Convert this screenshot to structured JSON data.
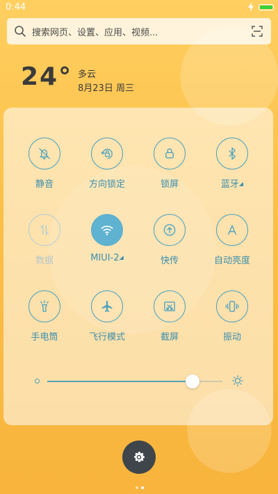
{
  "status_bar": {
    "time": "0:44",
    "battery_level": 1.0
  },
  "search": {
    "placeholder": "搜索网页、设置、应用、视频..."
  },
  "weather": {
    "temperature": "24°",
    "condition": "多云",
    "date": "8月23日 周三"
  },
  "quick_toggles": [
    {
      "label": "静音",
      "icon": "bell-off-icon",
      "state": "inactive"
    },
    {
      "label": "方向锁定",
      "icon": "rotation-lock-icon",
      "state": "inactive"
    },
    {
      "label": "锁屏",
      "icon": "lock-icon",
      "state": "inactive"
    },
    {
      "label": "蓝牙",
      "icon": "bluetooth-icon",
      "state": "inactive",
      "expandable": true
    },
    {
      "label": "数据",
      "icon": "mobile-data-icon",
      "state": "disabled"
    },
    {
      "label": "MIUI-2",
      "icon": "wifi-icon",
      "state": "active",
      "expandable": true
    },
    {
      "label": "快传",
      "icon": "quick-transfer-icon",
      "state": "inactive"
    },
    {
      "label": "自动亮度",
      "icon": "auto-brightness-icon",
      "state": "inactive"
    },
    {
      "label": "手电筒",
      "icon": "flashlight-icon",
      "state": "inactive"
    },
    {
      "label": "飞行模式",
      "icon": "airplane-icon",
      "state": "inactive"
    },
    {
      "label": "截屏",
      "icon": "screenshot-icon",
      "state": "inactive"
    },
    {
      "label": "振动",
      "icon": "vibrate-icon",
      "state": "inactive"
    }
  ],
  "brightness": {
    "level": 0.83
  },
  "pager": {
    "pages": 2,
    "current": 1
  },
  "colors": {
    "accent": "#4fa3be",
    "background": "#fcc04a",
    "active_toggle": "#5fb2d0"
  }
}
